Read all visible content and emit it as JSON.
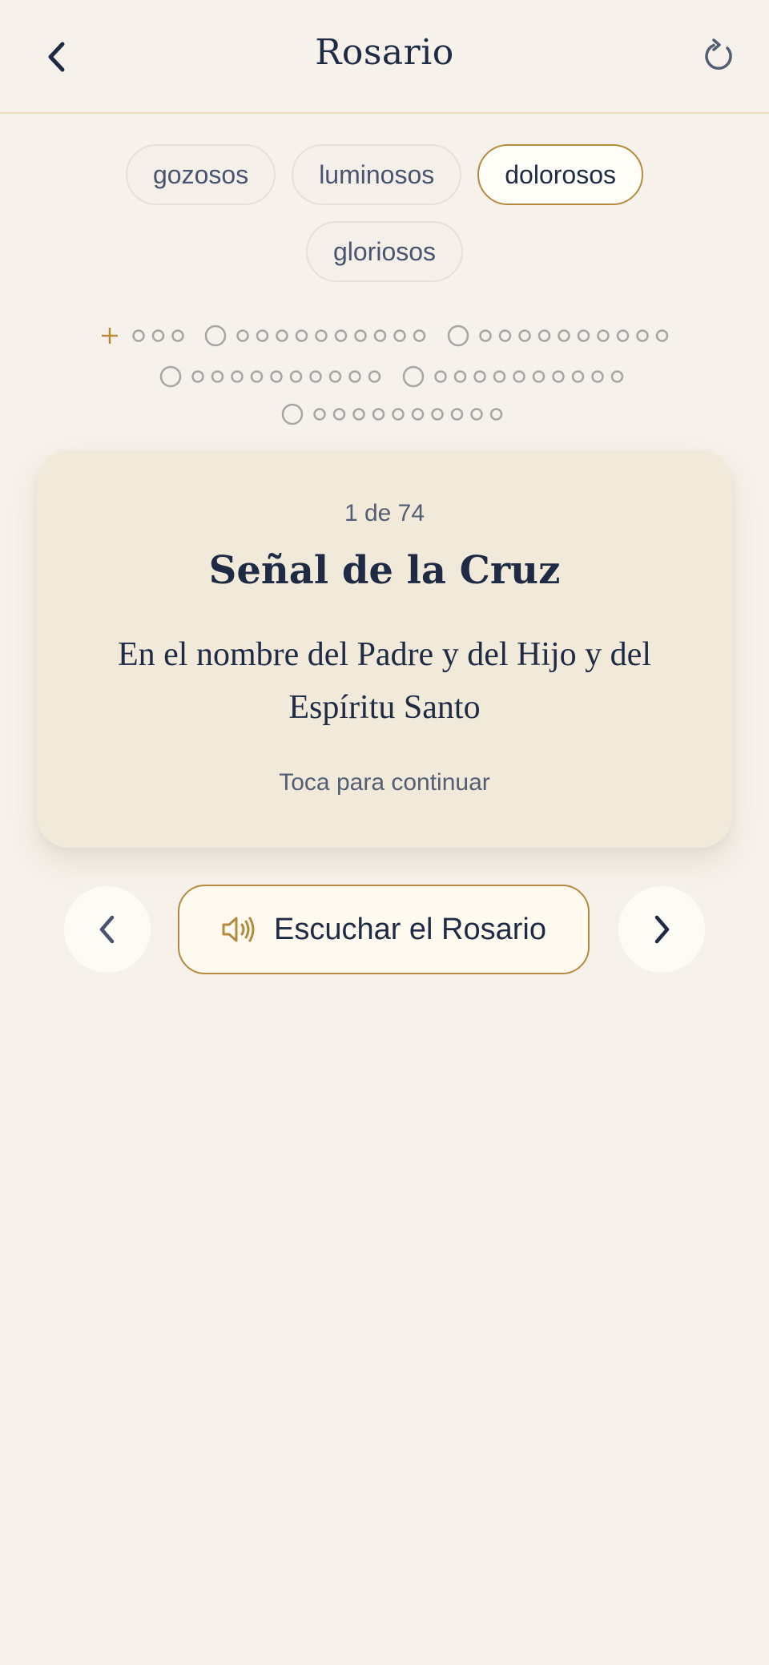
{
  "header": {
    "title": "Rosario",
    "back_icon": "chevron-left-icon",
    "refresh_icon": "refresh-icon"
  },
  "mysteries": {
    "options": [
      "gozosos",
      "luminosos",
      "dolorosos",
      "gloriosos"
    ],
    "selected": "dolorosos"
  },
  "progress": {
    "current": 1,
    "total": 74
  },
  "card": {
    "counter": "1 de 74",
    "title": "Señal de la Cruz",
    "text": "En el nombre del Padre y del Hijo y del Espíritu Santo",
    "hint": "Toca para continuar"
  },
  "controls": {
    "prev_icon": "chevron-left-icon",
    "next_icon": "chevron-right-icon",
    "listen_label": "Escuchar el Rosario",
    "listen_icon": "speaker-icon"
  },
  "colors": {
    "background": "#f6f1ea",
    "accent": "#b48a3c",
    "text": "#1f2a44",
    "muted": "#545d73",
    "bead": "#a6a6a6",
    "card": "#f1eadb"
  }
}
